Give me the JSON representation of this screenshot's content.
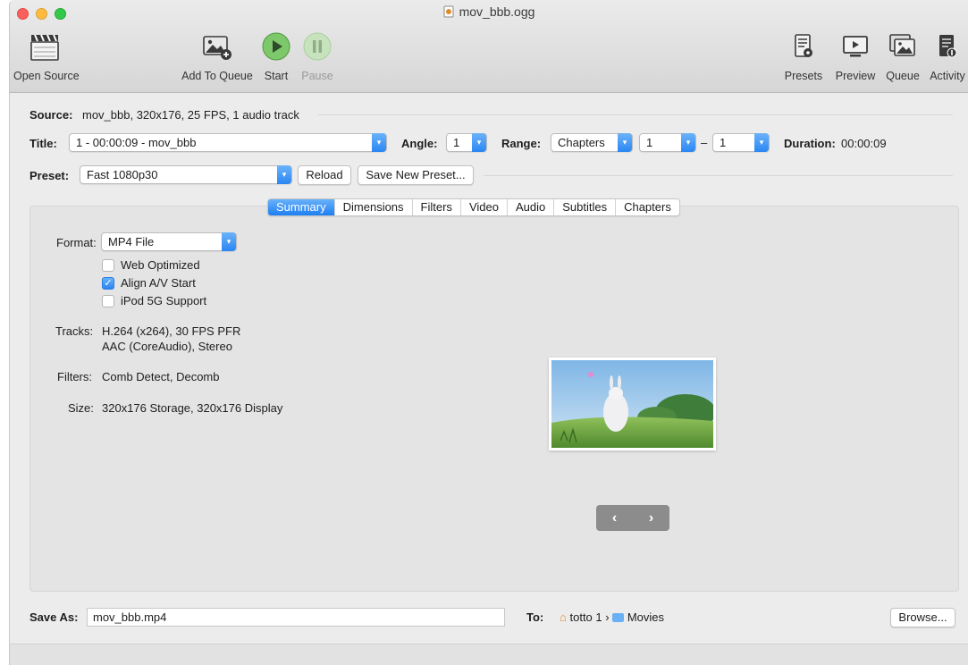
{
  "window": {
    "title": "mov_bbb.ogg"
  },
  "toolbar": {
    "open_source": "Open Source",
    "add_to_queue": "Add To Queue",
    "start": "Start",
    "pause": "Pause",
    "presets": "Presets",
    "preview": "Preview",
    "queue": "Queue",
    "activity": "Activity"
  },
  "source": {
    "label": "Source:",
    "value": "mov_bbb, 320x176, 25 FPS, 1 audio track"
  },
  "title_row": {
    "label": "Title:",
    "title_value": "1 - 00:00:09 - mov_bbb",
    "angle_label": "Angle:",
    "angle_value": "1",
    "range_label": "Range:",
    "range_type": "Chapters",
    "range_start": "1",
    "range_dash": "–",
    "range_end": "1",
    "duration_label": "Duration:",
    "duration_value": "00:00:09"
  },
  "preset_row": {
    "label": "Preset:",
    "value": "Fast 1080p30",
    "reload": "Reload",
    "save_new": "Save New Preset..."
  },
  "tabs": [
    "Summary",
    "Dimensions",
    "Filters",
    "Video",
    "Audio",
    "Subtitles",
    "Chapters"
  ],
  "summary": {
    "format_label": "Format:",
    "format_value": "MP4 File",
    "web_optimized": "Web Optimized",
    "align_av": "Align A/V Start",
    "ipod": "iPod 5G Support",
    "tracks_label": "Tracks:",
    "tracks_line1": "H.264 (x264), 30 FPS PFR",
    "tracks_line2": "AAC (CoreAudio), Stereo",
    "filters_label": "Filters:",
    "filters_value": "Comb Detect, Decomb",
    "size_label": "Size:",
    "size_value": "320x176 Storage, 320x176 Display",
    "checks": {
      "web_optimized": false,
      "align_av": true,
      "ipod": false
    }
  },
  "nav": {
    "prev": "‹",
    "next": "›"
  },
  "save": {
    "label": "Save As:",
    "filename": "mov_bbb.mp4",
    "to_label": "To:",
    "path_home": "totto 1",
    "path_sep": "›",
    "path_folder": "Movies",
    "browse": "Browse..."
  },
  "colors": {
    "accent": "#2a86f2",
    "start_green": "#5cb85c"
  }
}
